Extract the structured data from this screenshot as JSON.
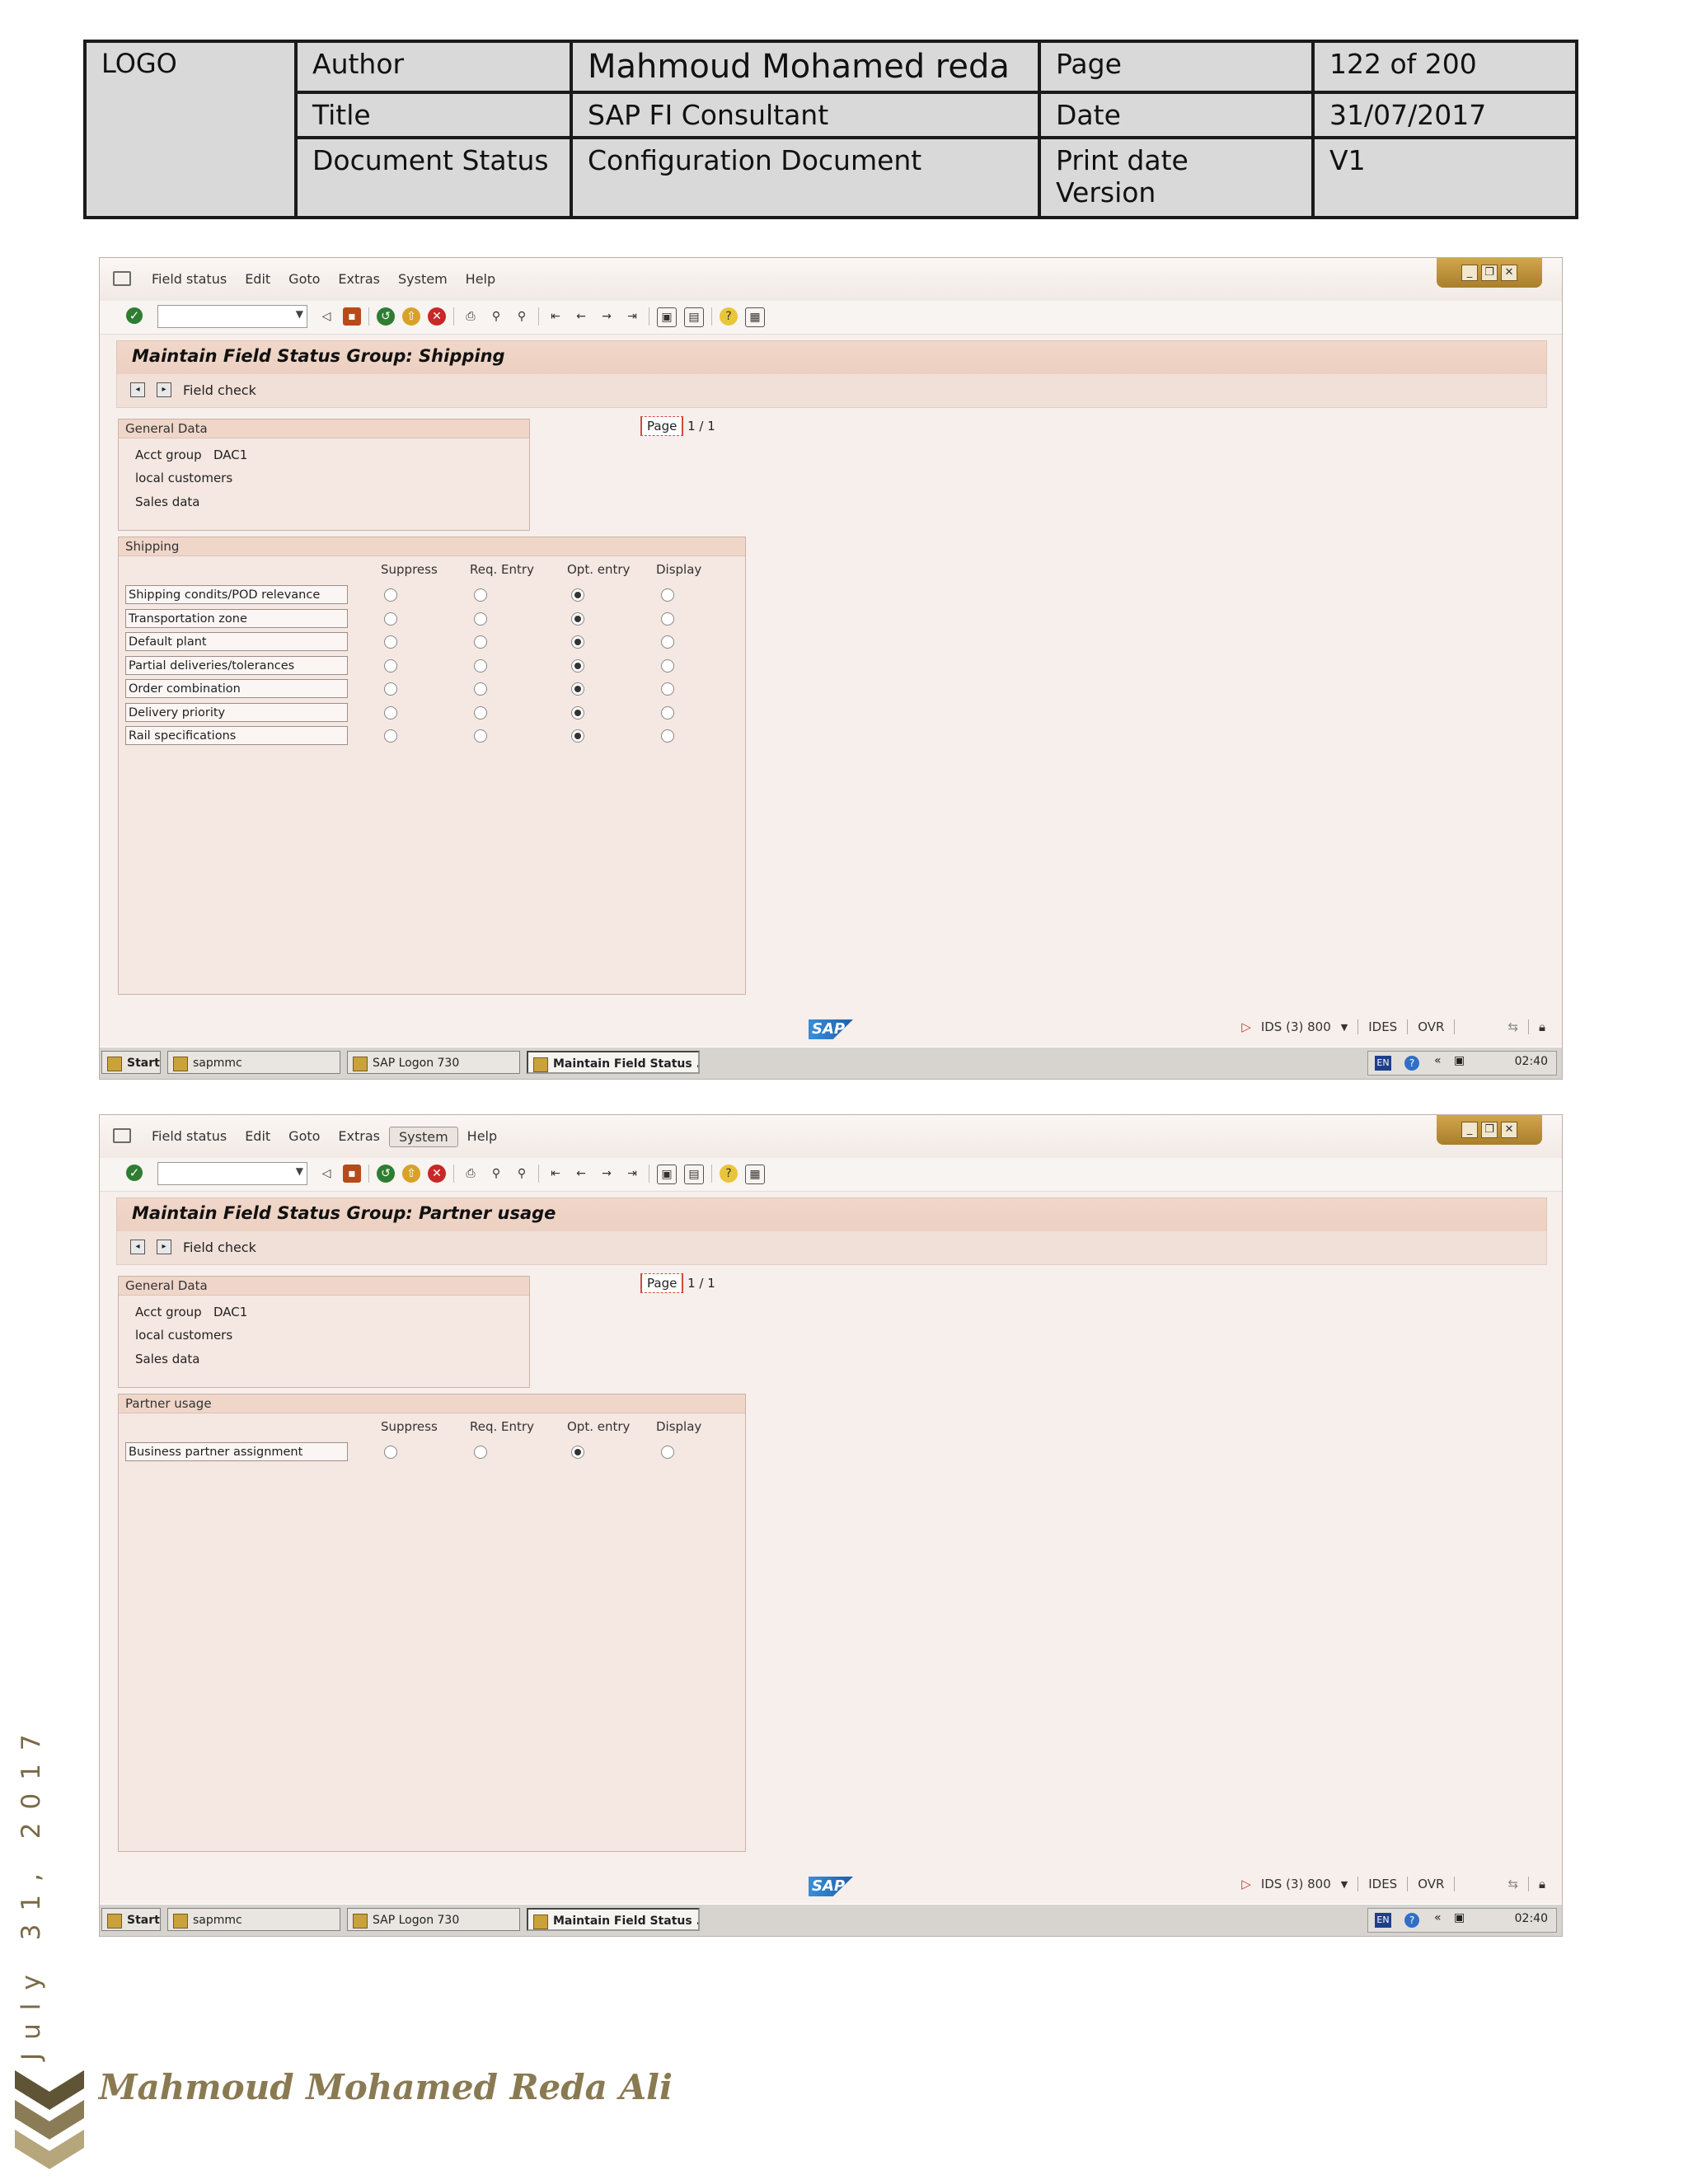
{
  "header": {
    "logo": "LOGO",
    "author_label": "Author",
    "author_value": "Mahmoud Mohamed reda",
    "page_label": "Page",
    "page_value": "122 of 200",
    "title_label": "Title",
    "title_value": "SAP FI Consultant",
    "date_label": "Date",
    "date_value": "31/07/2017",
    "status_label": "Document Status",
    "status_value": "Configuration Document",
    "version_label": "Print date Version",
    "version_value": "V1"
  },
  "screens": [
    {
      "menu": [
        "Field status",
        "Edit",
        "Goto",
        "Extras",
        "System",
        "Help"
      ],
      "title": "Maintain Field Status Group: Shipping",
      "field_check": "Field check",
      "general_data": {
        "title": "General Data",
        "acct_group_label": "Acct group",
        "acct_group_value": "DAC1",
        "line2": "local customers",
        "line3": "Sales data"
      },
      "page_label": "Page",
      "page_of": "1 / 1",
      "group_title": "Shipping",
      "columns": [
        "Suppress",
        "Req. Entry",
        "Opt. entry",
        "Display"
      ],
      "rows": [
        {
          "label": "Shipping condits/POD relevance",
          "selected": 2
        },
        {
          "label": "Transportation zone",
          "selected": 2
        },
        {
          "label": "Default plant",
          "selected": 2
        },
        {
          "label": "Partial deliveries/tolerances",
          "selected": 2
        },
        {
          "label": "Order combination",
          "selected": 2
        },
        {
          "label": "Delivery priority",
          "selected": 2
        },
        {
          "label": "Rail specifications",
          "selected": 2
        }
      ],
      "status": {
        "system": "IDS (3) 800",
        "server": "IDES",
        "mode": "OVR"
      },
      "taskbar": {
        "start": "Start",
        "item1": "sapmmc",
        "item2": "SAP Logon 730",
        "item3": "Maintain Field Status ...",
        "lang": "EN",
        "clock": "02:40"
      }
    },
    {
      "menu": [
        "Field status",
        "Edit",
        "Goto",
        "Extras",
        "System",
        "Help"
      ],
      "title": "Maintain Field Status Group: Partner usage",
      "field_check": "Field check",
      "general_data": {
        "title": "General Data",
        "acct_group_label": "Acct group",
        "acct_group_value": "DAC1",
        "line2": "local customers",
        "line3": "Sales data"
      },
      "page_label": "Page",
      "page_of": "1 / 1",
      "group_title": "Partner usage",
      "columns": [
        "Suppress",
        "Req. Entry",
        "Opt. entry",
        "Display"
      ],
      "rows": [
        {
          "label": "Business partner assignment",
          "selected": 2
        }
      ],
      "status": {
        "system": "IDS (3) 800",
        "server": "IDES",
        "mode": "OVR"
      },
      "taskbar": {
        "start": "Start",
        "item1": "sapmmc",
        "item2": "SAP Logon 730",
        "item3": "Maintain Field Status ...",
        "lang": "EN",
        "clock": "02:40"
      }
    }
  ],
  "footer": {
    "side_date": "July 31, 2017",
    "name": "Mahmoud Mohamed Reda Ali"
  }
}
